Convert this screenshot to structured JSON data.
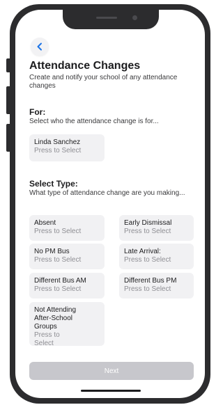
{
  "header": {
    "title": "Attendance Changes",
    "subtitle": "Create and notify your school of any attendance changes"
  },
  "for_section": {
    "title": "For:",
    "instruction": "Select who the attendance change is for...",
    "student": {
      "label": "Linda Sanchez",
      "hint": "Press to Select"
    }
  },
  "type_section": {
    "title": "Select Type:",
    "instruction": "What type of attendance change are you making...",
    "options": [
      {
        "label": "Absent",
        "hint": "Press to Select"
      },
      {
        "label": "Early Dismissal",
        "hint": "Press to Select"
      },
      {
        "label": "No PM Bus",
        "hint": "Press to Select"
      },
      {
        "label": "Late Arrival:",
        "hint": "Press to Select"
      },
      {
        "label": "Different Bus AM",
        "hint": "Press to Select"
      },
      {
        "label": "Different Bus PM",
        "hint": "Press to Select"
      },
      {
        "label": "Not Attending After-School Groups",
        "hint": "Press to Select"
      }
    ]
  },
  "footer": {
    "next_label": "Next"
  },
  "icons": {
    "back": "chevron-left-icon"
  },
  "colors": {
    "accent": "#1a73e8",
    "card": "#f1f1f3",
    "button_disabled": "#c7c7cc"
  }
}
